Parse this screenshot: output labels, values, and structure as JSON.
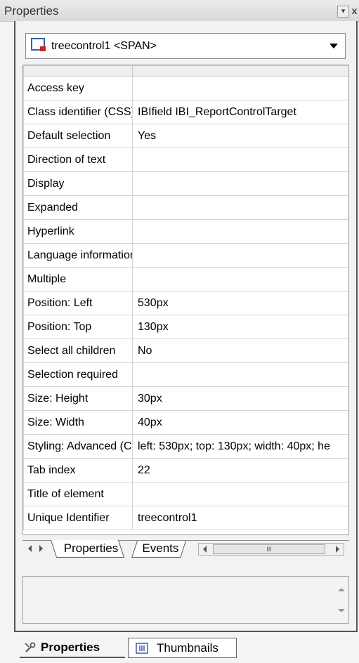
{
  "panel": {
    "title": "Properties"
  },
  "element_selector": {
    "value": "treecontrol1 <SPAN>"
  },
  "properties": [
    {
      "name": "Access key",
      "value": ""
    },
    {
      "name": "Class identifier (CSS)",
      "value": "IBIfield IBI_ReportControlTarget"
    },
    {
      "name": "Default selection",
      "value": "Yes"
    },
    {
      "name": "Direction of text",
      "value": ""
    },
    {
      "name": "Display",
      "value": ""
    },
    {
      "name": "Expanded",
      "value": ""
    },
    {
      "name": "Hyperlink",
      "value": ""
    },
    {
      "name": "Language information",
      "value": ""
    },
    {
      "name": "Multiple",
      "value": ""
    },
    {
      "name": "Position: Left",
      "value": "530px"
    },
    {
      "name": "Position: Top",
      "value": "130px"
    },
    {
      "name": "Select all children",
      "value": "No"
    },
    {
      "name": "Selection required",
      "value": ""
    },
    {
      "name": "Size: Height",
      "value": "30px"
    },
    {
      "name": "Size: Width",
      "value": "40px"
    },
    {
      "name": "Styling: Advanced (CSS)",
      "value": "left: 530px; top: 130px; width: 40px; he"
    },
    {
      "name": "Tab index",
      "value": "22"
    },
    {
      "name": "Title of element",
      "value": ""
    },
    {
      "name": "Unique Identifier",
      "value": "treecontrol1"
    }
  ],
  "inner_tabs": {
    "properties": "Properties",
    "events": "Events",
    "scroll_thumb": "III"
  },
  "bottom_tabs": {
    "properties": "Properties",
    "thumbnails": "Thumbnails"
  },
  "colors": {
    "frame": "#555555",
    "grid_line": "#d4d4d4",
    "accent_red": "#cc2222",
    "icon_blue": "#3a5fa8"
  }
}
